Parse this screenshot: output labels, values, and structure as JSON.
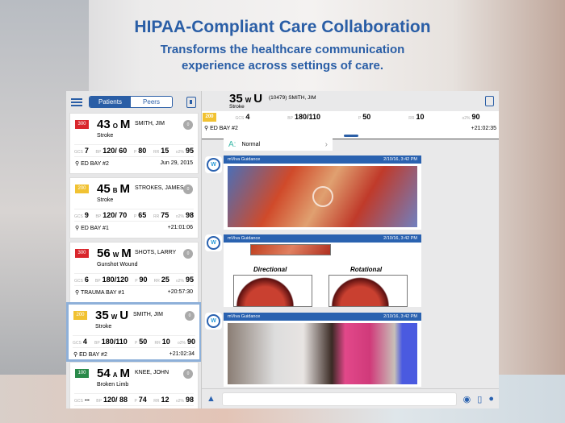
{
  "headline": "HIPAA-Compliant Care Collaboration",
  "subline1": "Transforms the healthcare communication",
  "subline2": "experience across settings of care.",
  "tabs": {
    "patients": "Patients",
    "peers": "Peers"
  },
  "colors": {
    "red": "#d9262c",
    "yellow": "#f1c232",
    "green": "#2a8a4a",
    "brand": "#2a5ea6"
  },
  "patients": [
    {
      "acuity": "300",
      "color": "#d9262c",
      "age": "43",
      "race": "O",
      "sex": "M",
      "name": "SMITH, JIM",
      "dx": "Stroke",
      "msgs": "0",
      "gcs": "7",
      "bp": "120/ 60",
      "p": "80",
      "rr": "15",
      "o2": "95",
      "loc": "ED BAY #2",
      "time": "Jun 29, 2015"
    },
    {
      "acuity": "200",
      "color": "#f1c232",
      "age": "45",
      "race": "B",
      "sex": "M",
      "name": "STROKES, JAMES",
      "dx": "Stroke",
      "msgs": "0",
      "gcs": "9",
      "bp": "120/ 70",
      "p": "65",
      "rr": "75",
      "o2": "98",
      "loc": "ED BAY #1",
      "time": "+21:01:06"
    },
    {
      "acuity": "300",
      "color": "#d9262c",
      "age": "56",
      "race": "W",
      "sex": "M",
      "name": "SHOTS, LARRY",
      "dx": "Gunshot Wound",
      "msgs": "0",
      "gcs": "6",
      "bp": "180/120",
      "p": "90",
      "rr": "25",
      "o2": "95",
      "loc": "TRAUMA BAY #1",
      "time": "+20:57:30"
    },
    {
      "acuity": "200",
      "color": "#f1c232",
      "age": "35",
      "race": "W",
      "sex": "U",
      "name": "SMITH, JIM",
      "dx": "Stroke",
      "msgs": "0",
      "gcs": "4",
      "bp": "180/110",
      "p": "50",
      "rr": "10",
      "o2": "90",
      "loc": "ED BAY #2",
      "time": "+21:02:34"
    },
    {
      "acuity": "100",
      "color": "#2a8a4a",
      "age": "54",
      "race": "A",
      "sex": "M",
      "name": "KNEE, JOHN",
      "dx": "Broken Limb",
      "msgs": "0",
      "gcs": "--",
      "bp": "120/ 88",
      "p": "74",
      "rr": "12",
      "o2": "98",
      "loc": "",
      "time": ""
    }
  ],
  "labels": {
    "gcs": "GCS",
    "bp": "BP",
    "p": "P",
    "rr": "RR",
    "o2": "o2%"
  },
  "detail": {
    "age": "35",
    "race": "W",
    "sex": "U",
    "name": "(10479) SMITH, JIM",
    "dx": "Stroke",
    "acuity": "200",
    "gcs": "4",
    "bp": "180/110",
    "p": "50",
    "rr": "10",
    "o2": "90",
    "loc": "ED BAY #2",
    "time": "+21:02:35"
  },
  "assessment": {
    "letter": "A:",
    "value": "Normal"
  },
  "messages": [
    {
      "sender": "mViva Guidance",
      "time": "2/10/16, 3:42 PM"
    },
    {
      "sender": "mViva Guidance",
      "time": "2/10/16, 3:42 PM",
      "captions": [
        "Directional",
        "Rotational"
      ]
    },
    {
      "sender": "mViva Guidance",
      "time": "2/10/16, 3:42 PM"
    }
  ],
  "avatar": "W"
}
